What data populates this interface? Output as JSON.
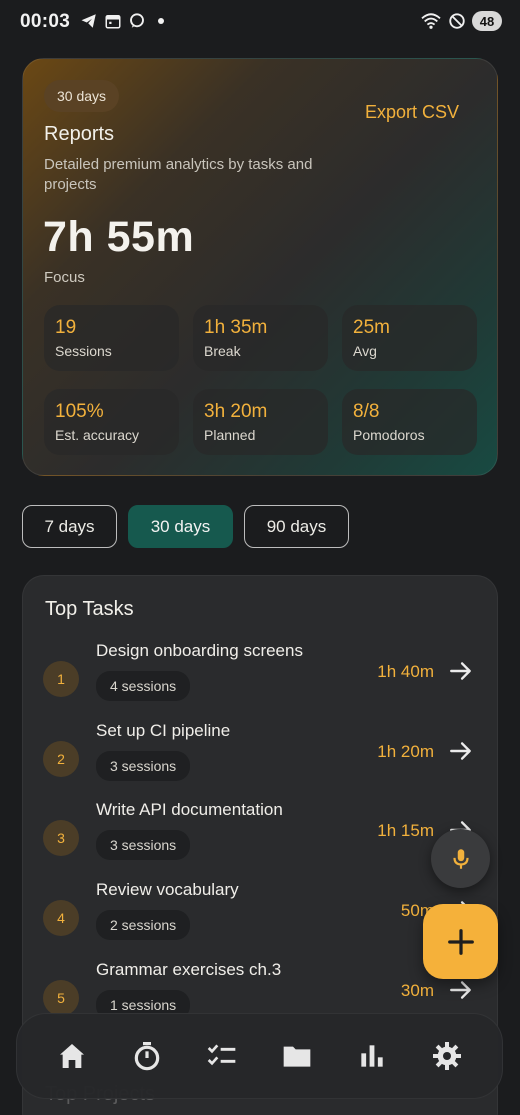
{
  "status_bar": {
    "time": "00:03",
    "battery": "48"
  },
  "hero": {
    "range_pill": "30 days",
    "export_label": "Export CSV",
    "title": "Reports",
    "subtitle": "Detailed premium analytics by tasks and projects",
    "focus_value": "7h 55m",
    "focus_label": "Focus",
    "stats": [
      {
        "value": "19",
        "label": "Sessions"
      },
      {
        "value": "1h 35m",
        "label": "Break"
      },
      {
        "value": "25m",
        "label": "Avg"
      },
      {
        "value": "105%",
        "label": "Est. accuracy"
      },
      {
        "value": "3h 20m",
        "label": "Planned"
      },
      {
        "value": "8/8",
        "label": "Pomodoros"
      }
    ]
  },
  "ranges": [
    {
      "label": "7 days",
      "active": false
    },
    {
      "label": "30 days",
      "active": true
    },
    {
      "label": "90 days",
      "active": false
    }
  ],
  "top_tasks": {
    "title": "Top Tasks",
    "items": [
      {
        "rank": "1",
        "name": "Design onboarding screens",
        "sessions": "4 sessions",
        "duration": "1h 40m"
      },
      {
        "rank": "2",
        "name": "Set up CI pipeline",
        "sessions": "3 sessions",
        "duration": "1h 20m"
      },
      {
        "rank": "3",
        "name": "Write API documentation",
        "sessions": "3 sessions",
        "duration": "1h 15m"
      },
      {
        "rank": "4",
        "name": "Review vocabulary",
        "sessions": "2 sessions",
        "duration": "50m"
      },
      {
        "rank": "5",
        "name": "Grammar exercises ch.3",
        "sessions": "1 sessions",
        "duration": "30m"
      }
    ]
  },
  "top_projects_title": "Top Projects",
  "colors": {
    "accent": "#f2b13c",
    "active_range": "#16594e",
    "fab": "#f5b13a"
  },
  "nav": {
    "items": [
      {
        "icon": "home-icon"
      },
      {
        "icon": "timer-icon"
      },
      {
        "icon": "checklist-icon"
      },
      {
        "icon": "folder-icon"
      },
      {
        "icon": "bar-chart-icon"
      },
      {
        "icon": "settings-gear-icon"
      }
    ]
  }
}
